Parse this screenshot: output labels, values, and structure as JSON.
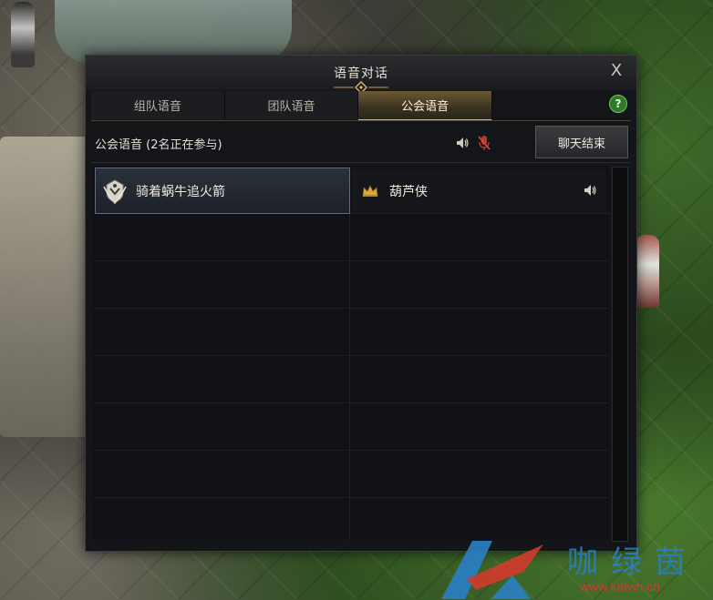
{
  "dialog": {
    "title": "语音对话",
    "close": "X",
    "help": "?"
  },
  "tabs": [
    {
      "label": "组队语音",
      "active": false
    },
    {
      "label": "团队语音",
      "active": false
    },
    {
      "label": "公会语音",
      "active": true
    }
  ],
  "channel": {
    "status": "公会语音 (2名正在参与)",
    "end_button": "聊天结束"
  },
  "members": [
    {
      "name": "骑着蜗牛追火箭",
      "icon": "guild-emblem-icon",
      "selected": true
    },
    {
      "name": "葫芦侠",
      "icon": "crown-icon",
      "speaking": true
    }
  ],
  "watermark": {
    "logo_text": "咖绿茵",
    "url": "www.kalvin.cn"
  },
  "colors": {
    "active_tab": "#6a5a33",
    "muted_mic": "#c0392b",
    "help": "#2d7a2b",
    "selected_border": "#5c6b82"
  }
}
